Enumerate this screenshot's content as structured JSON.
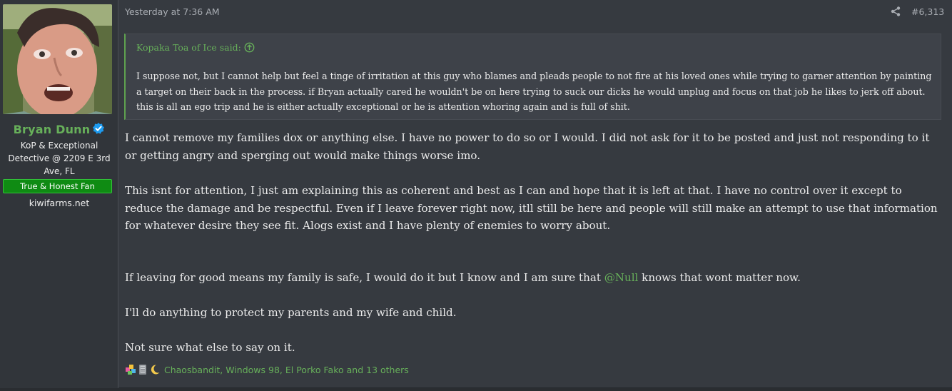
{
  "user": {
    "name": "Bryan Dunn",
    "title": "KoP & Exceptional Detective @ 2209 E 3rd Ave, FL",
    "banner": "True & Honest Fan",
    "site": "kiwifarms.net"
  },
  "post": {
    "timestamp": "Yesterday at 7:36 AM",
    "number": "#6,313",
    "quote": {
      "author": "Kopaka Toa of Ice said:",
      "text": "I suppose not, but I cannot help but feel a tinge of irritation at this guy who blames and pleads people to not fire at his loved ones while trying to garner attention by painting a target on their back in the process. if Bryan actually cared he wouldn't be on here trying to suck our dicks he would unplug and focus on that job he likes to jerk off about. this is all an ego trip and he is either actually exceptional or he is attention whoring again and is full of shit."
    },
    "paragraphs": {
      "p1": "I cannot remove my families dox or anything else. I have no power to do so or I would. I did not ask for it to be posted and just not responding to it or getting angry and sperging out would make things worse imo.",
      "p2": "This isnt for attention, I just am explaining this as coherent and best as I can and hope that it is left at that. I have no control over it except to reduce the damage and be respectful. Even if I leave forever right now, itll still be here and people will still make an attempt to use that information for whatever desire they see fit. Alogs exist and I have plenty of enemies to worry about.",
      "p3_before": "If leaving for good means my family is safe, I would do it but I know and I am sure that ",
      "p3_mention": "@Null",
      "p3_after": " knows that wont matter now.",
      "p4": "I'll do anything to protect my parents and my wife and child.",
      "p5": "Not sure what else to say on it."
    },
    "reactions": {
      "text": "Chaosbandit, Windows 98, El Porko Fako and 13 others",
      "icons": [
        "puzzle-icon",
        "tablet-icon",
        "moon-icon"
      ]
    }
  },
  "colors": {
    "accent": "#67b05a",
    "background": "#363a40",
    "sidebar": "#31353a",
    "quote_bg": "#3e4249",
    "banner": "#0f8b13",
    "verified": "#1d9bf0"
  }
}
